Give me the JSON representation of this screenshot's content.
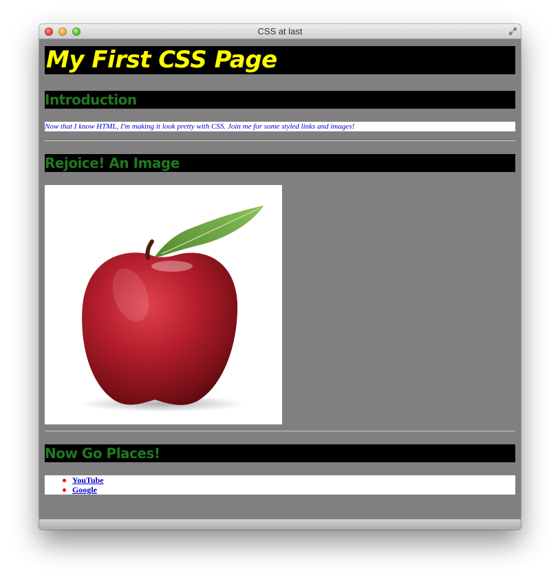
{
  "window": {
    "title": "CSS at last"
  },
  "page": {
    "heading": "My First CSS Page",
    "sections": {
      "intro": {
        "heading": "Introduction",
        "text": "Now that I know HTML, I'm making it look pretty with CSS. Join me for some styled links and images!"
      },
      "image": {
        "heading": "Rejoice! An Image",
        "image_subject": "red apple with leaf"
      },
      "links": {
        "heading": "Now Go Places!",
        "items": [
          {
            "label": "YouTube"
          },
          {
            "label": "Google"
          }
        ]
      }
    }
  },
  "colors": {
    "page_background": "#808080",
    "heading_background": "#000000",
    "h1_text": "#ffff00",
    "h2_text": "#1f7a1f",
    "paragraph_text": "#0000cc",
    "link_text": "#0000cc",
    "bullet": "#ff0000"
  },
  "icons": {
    "close": "close-traffic-light-icon",
    "minimize": "minimize-traffic-light-icon",
    "zoom": "zoom-traffic-light-icon",
    "fullscreen": "fullscreen-arrows-icon"
  }
}
